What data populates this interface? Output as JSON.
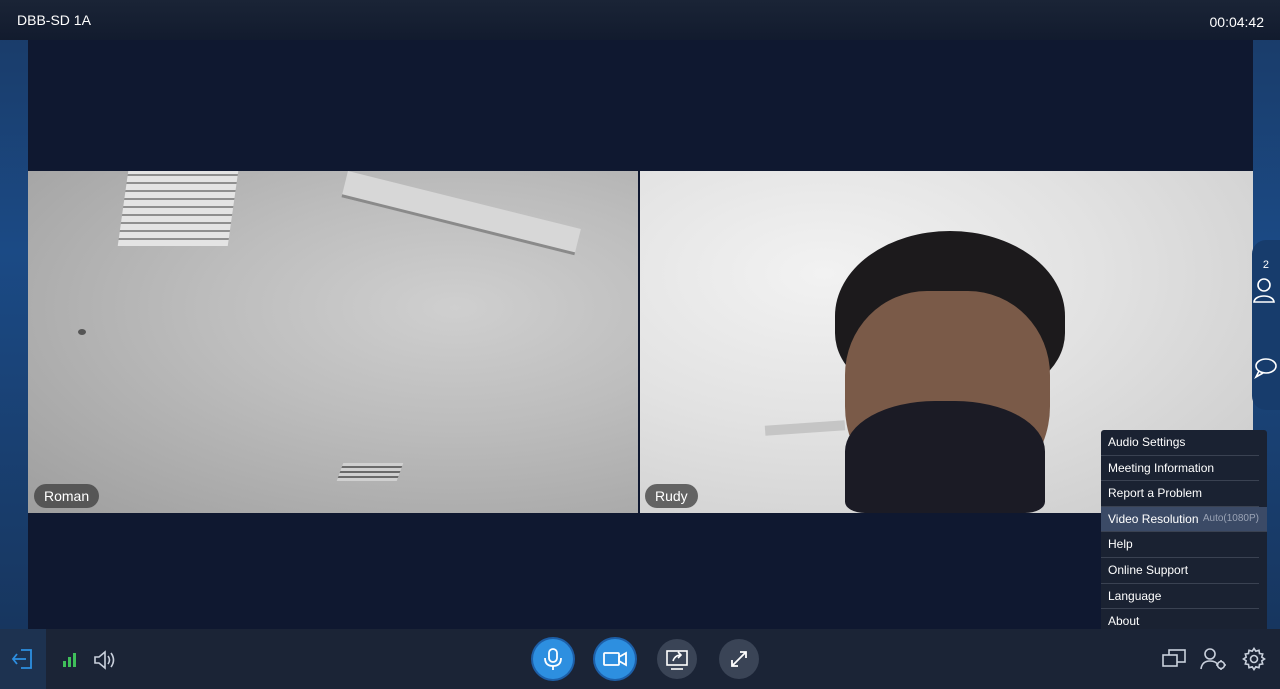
{
  "header": {
    "room_name": "DBB-SD 1A",
    "timer": "00:04:42"
  },
  "participants": {
    "count": "2",
    "tiles": [
      {
        "name": "Roman"
      },
      {
        "name": "Rudy"
      }
    ]
  },
  "settings_menu": {
    "items": [
      {
        "label": "Audio Settings"
      },
      {
        "label": "Meeting Information"
      },
      {
        "label": "Report a Problem"
      },
      {
        "label": "Video Resolution",
        "sub": "Auto(1080P)"
      },
      {
        "label": "Help"
      },
      {
        "label": "Online Support"
      },
      {
        "label": "Language"
      },
      {
        "label": "About"
      }
    ]
  },
  "colors": {
    "accent_blue": "#2d8fe0",
    "background": "#0f1830",
    "signal_green": "#3fbf5a"
  },
  "icons": {
    "exit": "exit-icon",
    "signal": "signal-icon",
    "speaker": "speaker-icon",
    "mic": "microphone-icon",
    "camera": "camera-icon",
    "share": "share-screen-icon",
    "fullscreen": "fullscreen-icon",
    "layout": "layout-icon",
    "participants": "participants-icon",
    "settings": "gear-icon",
    "chat": "chat-icon"
  }
}
